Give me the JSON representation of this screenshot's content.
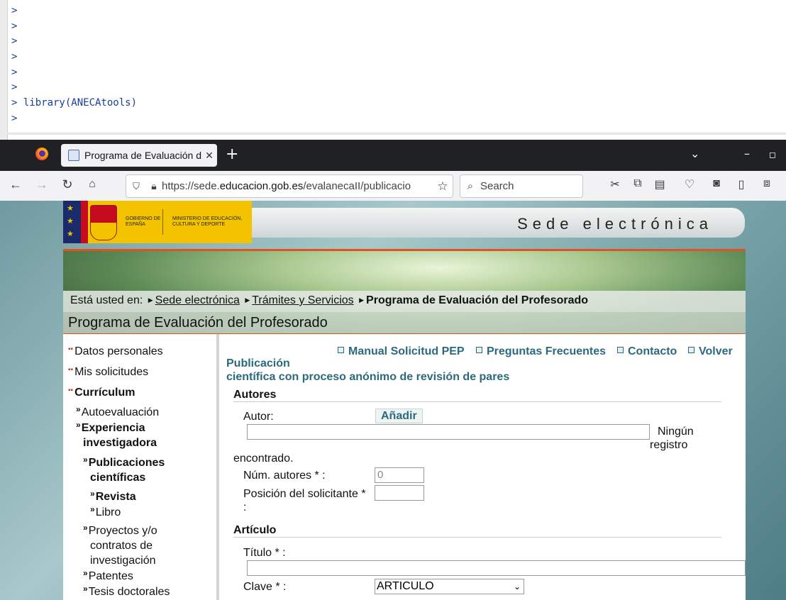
{
  "console": {
    "prompt": ">",
    "lines": [
      ">",
      ">",
      ">",
      ">",
      ">",
      ">",
      "> library(ANECAtools)",
      ">"
    ]
  },
  "browser": {
    "tab_title": "Programa de Evaluación d",
    "url_prefix": "https://sede.",
    "url_domain": "educacion.gob.es",
    "url_rest": "/evalanecaII/publicacio",
    "search_placeholder": "Search"
  },
  "icons": {
    "firefox": "firefox-icon",
    "tab_close": "close-icon",
    "new_tab": "plus-icon",
    "back": "arrow-left-icon",
    "forward": "arrow-right-icon",
    "reload": "reload-icon",
    "home": "home-icon",
    "shield": "shield-icon",
    "lock": "lock-icon",
    "bookmark": "star-icon",
    "search": "search-icon",
    "cut": "cut-icon",
    "copy": "copy-icon",
    "clipboard": "clipboard-icon",
    "pocket": "pocket-icon",
    "extension": "extension-icon",
    "reader": "page-icon",
    "extensions": "puzzle-icon"
  },
  "header": {
    "logo_gobierno": "GOBIERNO DE ESPAÑA",
    "logo_ministerio": "MINISTERIO DE EDUCACIÓN, CULTURA Y DEPORTE",
    "sede": "Sede electrónica"
  },
  "breadcrumb": {
    "prefix": "Está usted en:",
    "items": [
      "Sede electrónica",
      "Trámites y Servicios",
      "Programa de Evaluación del Profesorado"
    ]
  },
  "page_title": "Programa de Evaluación del Profesorado",
  "sidebar": {
    "datos": "Datos personales",
    "solicitudes": "Mis solicitudes",
    "curriculum": "Currículum",
    "autoeval": "Autoevaluación",
    "exp1": "Experiencia",
    "exp2": "investigadora",
    "pub1": "Publicaciones",
    "pub2": "científicas",
    "revista": "Revista",
    "libro": "Libro",
    "proy1": "Proyectos y/o",
    "proy2": "contratos de",
    "proy3": "investigación",
    "patentes": "Patentes",
    "tesis": "Tesis doctorales"
  },
  "toplinks": {
    "manual": "Manual Solicitud PEP",
    "preguntas": "Preguntas Frecuentes",
    "contacto": "Contacto",
    "volver": "Volver"
  },
  "form": {
    "title_line1": "Publicación",
    "title_line2": "científica con proceso anónimo de revisión de pares",
    "autores_section": "Autores",
    "autor_label": "Autor:",
    "add_button": "Añadir",
    "autor_value": "",
    "ninguno1": "Ningún",
    "ninguno2": "registro",
    "encontrado": "encontrado.",
    "num_autores_label": "Núm. autores * :",
    "num_autores_value": "0",
    "posicion_label1": "Posición del solicitante *",
    "posicion_label2": ":",
    "posicion_value": "",
    "articulo_section": "Artículo",
    "titulo_label": "Título * :",
    "titulo_value": "",
    "clave_label": "Clave * :",
    "clave_value": "ARTICULO"
  }
}
